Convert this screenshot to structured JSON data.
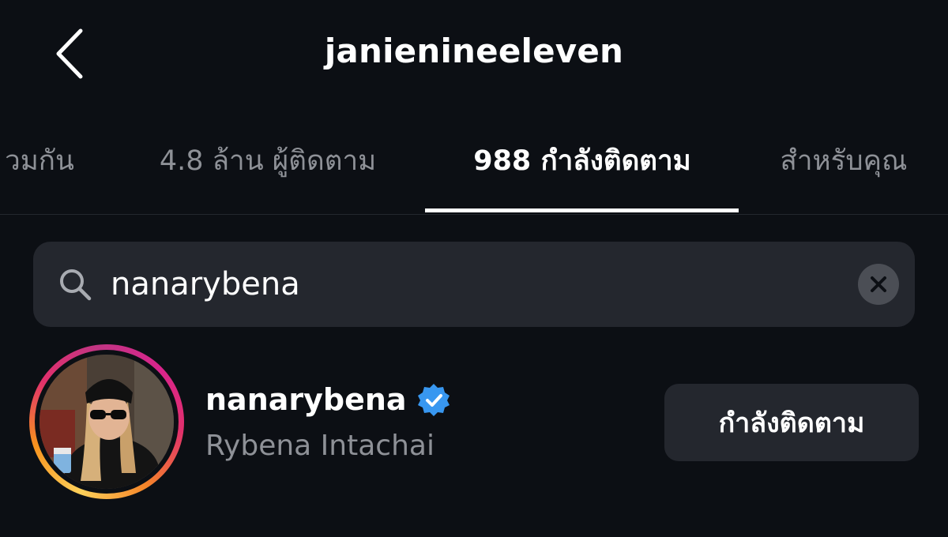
{
  "header": {
    "title": "janienineeleven",
    "back_icon": "chevron-left-icon"
  },
  "tabs": [
    {
      "label": "วมกัน",
      "active": false
    },
    {
      "label": "4.8 ล้าน ผู้ติดตาม",
      "active": false
    },
    {
      "label": "988 กำลังติดตาม",
      "active": true
    },
    {
      "label": "สำหรับคุณ",
      "active": false
    }
  ],
  "search": {
    "value": "nanarybena",
    "placeholder": "",
    "search_icon": "search-icon",
    "clear_icon": "clear-icon"
  },
  "results": [
    {
      "username": "nanarybena",
      "full_name": "Rybena Intachai",
      "verified": true,
      "button_label": "กำลังติดตาม"
    }
  ],
  "colors": {
    "background": "#0c0f14",
    "surface": "#24272e",
    "text_primary": "#ffffff",
    "text_secondary": "#8e9197",
    "verified_blue": "#3897f0"
  }
}
